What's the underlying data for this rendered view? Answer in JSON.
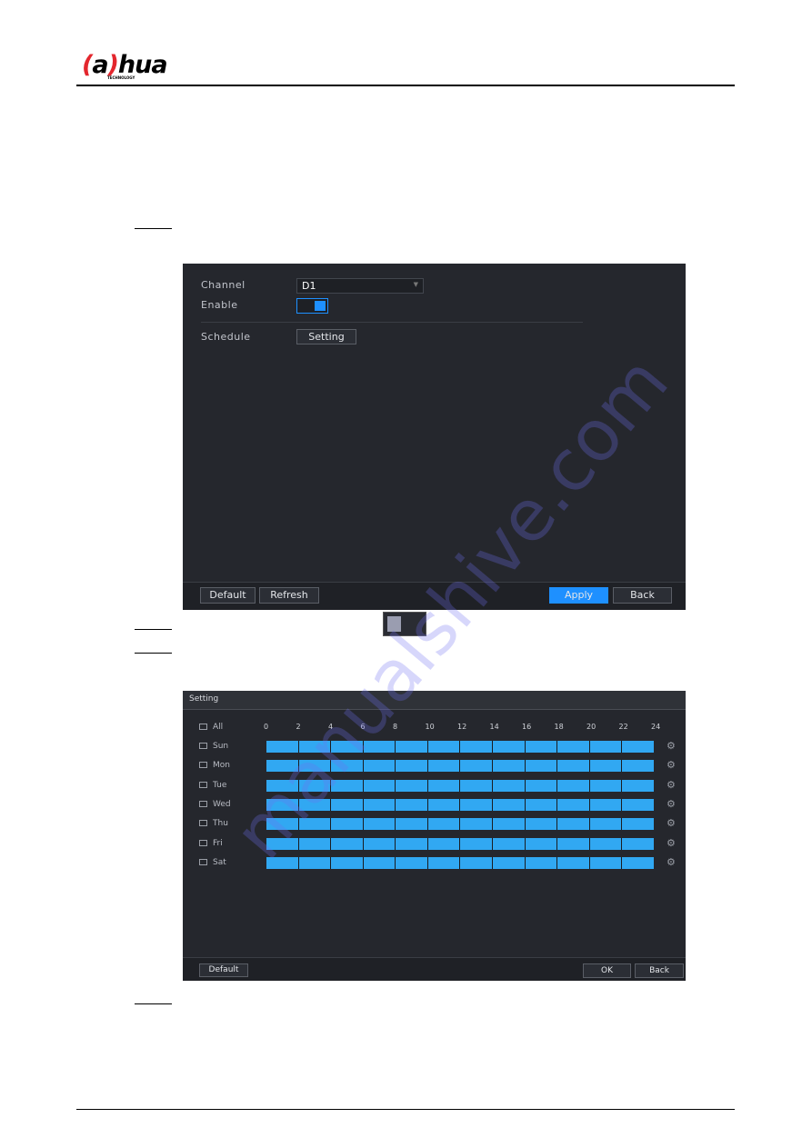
{
  "header": {
    "logo_text": "alhua",
    "logo_subtext": "TECHNOLOGY",
    "brand_color": "#e3262d"
  },
  "watermark": "manualshive.com",
  "shot1": {
    "channel_label": "Channel",
    "channel_value": "D1",
    "enable_label": "Enable",
    "enable_on": true,
    "schedule_label": "Schedule",
    "setting_button": "Setting",
    "buttons": {
      "default": "Default",
      "refresh": "Refresh",
      "apply": "Apply",
      "back": "Back"
    },
    "accent": "#1e90ff"
  },
  "toggle_image": {
    "enabled": false
  },
  "shot2": {
    "title": "Setting",
    "all_label": "All",
    "hours": [
      "0",
      "2",
      "4",
      "6",
      "8",
      "10",
      "12",
      "14",
      "16",
      "18",
      "20",
      "22",
      "24"
    ],
    "days": [
      "Sun",
      "Mon",
      "Tue",
      "Wed",
      "Thu",
      "Fri",
      "Sat"
    ],
    "bar_color": "#31a8f2",
    "buttons": {
      "default": "Default",
      "ok": "OK",
      "back": "Back"
    }
  }
}
